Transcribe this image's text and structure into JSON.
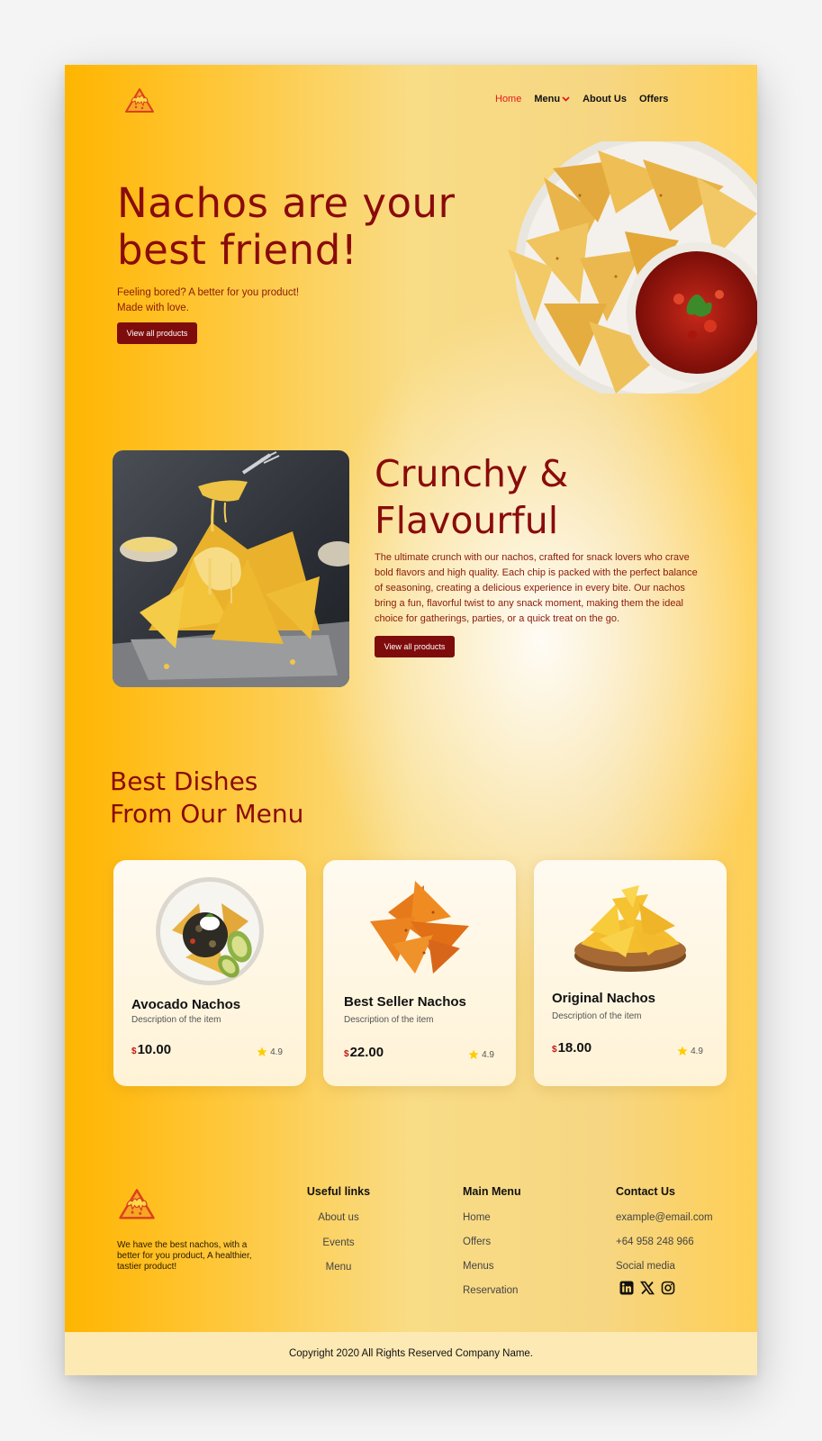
{
  "nav": {
    "items": [
      "Home",
      "Menu",
      "About Us",
      "Offers"
    ]
  },
  "hero": {
    "title": "Nachos are your best friend!",
    "subtitle_line1": "Feeling bored? A better for you product!",
    "subtitle_line2": "Made with love.",
    "button": "View all products"
  },
  "crunchy": {
    "title_line1": "Crunchy &",
    "title_line2": "Flavourful",
    "body": "The ultimate crunch with our nachos, crafted for snack lovers who crave bold flavors and high quality. Each chip is packed with the perfect balance of seasoning, creating a delicious experience in every bite. Our nachos bring a fun, flavorful twist to any snack moment, making them the ideal choice for gatherings, parties, or a quick treat on the go.",
    "button": "View all products"
  },
  "menu_section": {
    "title_line1": "Best Dishes",
    "title_line2": "From Our Menu",
    "cards": [
      {
        "name": "Avocado Nachos",
        "description": "Description of the item",
        "currency": "$",
        "price": "10.00",
        "rating": "4.9"
      },
      {
        "name": "Best Seller Nachos",
        "description": "Description of the item",
        "currency": "$",
        "price": "22.00",
        "rating": "4.9"
      },
      {
        "name": "Original Nachos",
        "description": "Description of the item",
        "currency": "$",
        "price": "18.00",
        "rating": "4.9"
      }
    ]
  },
  "footer": {
    "about": "We have the best nachos, with a better for you product, A healthier, tastier product!",
    "useful_links": {
      "heading": "Useful links",
      "items": [
        "About us",
        "Events",
        "Menu"
      ]
    },
    "main_menu": {
      "heading": "Main Menu",
      "items": [
        "Home",
        "Offers",
        "Menus",
        "Reservation"
      ]
    },
    "contact": {
      "heading": "Contact Us",
      "email": "example@email.com",
      "phone": "+64 958 248 966",
      "social_label": "Social media"
    },
    "copyright": "Copyright 2020 All Rights Reserved Company Name."
  },
  "colors": {
    "accent": "#8a0b0b",
    "nav_active": "#e31b1b",
    "button": "#7f0c0c",
    "rating_star": "#ffcc00"
  }
}
